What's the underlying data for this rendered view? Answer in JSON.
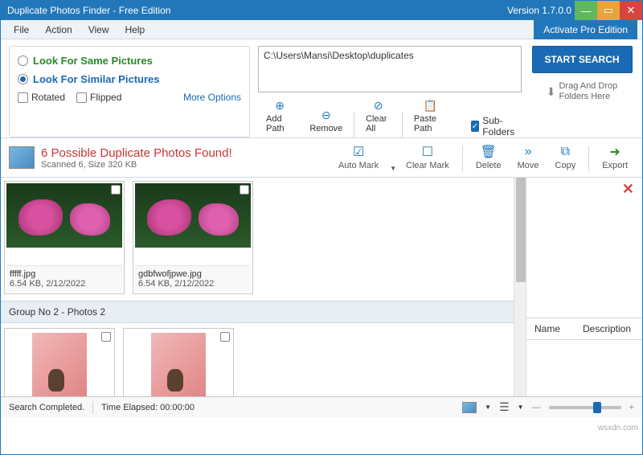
{
  "title": "Duplicate Photos Finder - Free Edition",
  "version": "Version 1.7.0.0",
  "activate": "Activate Pro Edition",
  "menu": {
    "file": "File",
    "action": "Action",
    "view": "View",
    "help": "Help"
  },
  "search": {
    "same": "Look For Same Pictures",
    "similar": "Look For Similar Pictures",
    "rotated": "Rotated",
    "flipped": "Flipped",
    "more": "More Options"
  },
  "path": "C:\\Users\\Mansi\\Desktop\\duplicates",
  "pathtools": {
    "add": "Add Path",
    "remove": "Remove",
    "clear": "Clear All",
    "paste": "Paste Path",
    "subfolders": "Sub-Folders"
  },
  "start": "START SEARCH",
  "dragdrop": {
    "l1": "Drag And Drop",
    "l2": "Folders Here"
  },
  "result": {
    "headline": "6 Possible Duplicate Photos Found!",
    "sub": "Scanned 6, Size 320 KB"
  },
  "actions": {
    "automark": "Auto Mark",
    "clearmark": "Clear Mark",
    "delete": "Delete",
    "move": "Move",
    "copy": "Copy",
    "export": "Export"
  },
  "thumbs": [
    {
      "filename": "fffff.jpg",
      "meta": "6.54 KB, 2/12/2022"
    },
    {
      "filename": "gdbfwofjpwe.jpg",
      "meta": "6.54 KB, 2/12/2022"
    }
  ],
  "group2": "Group No 2  -  Photos 2",
  "details": {
    "name": "Name",
    "desc": "Description"
  },
  "status": {
    "completed": "Search Completed.",
    "elapsed_lbl": "Time Elapsed:",
    "elapsed": "00:00:00"
  },
  "watermark": "wsxdn.com"
}
